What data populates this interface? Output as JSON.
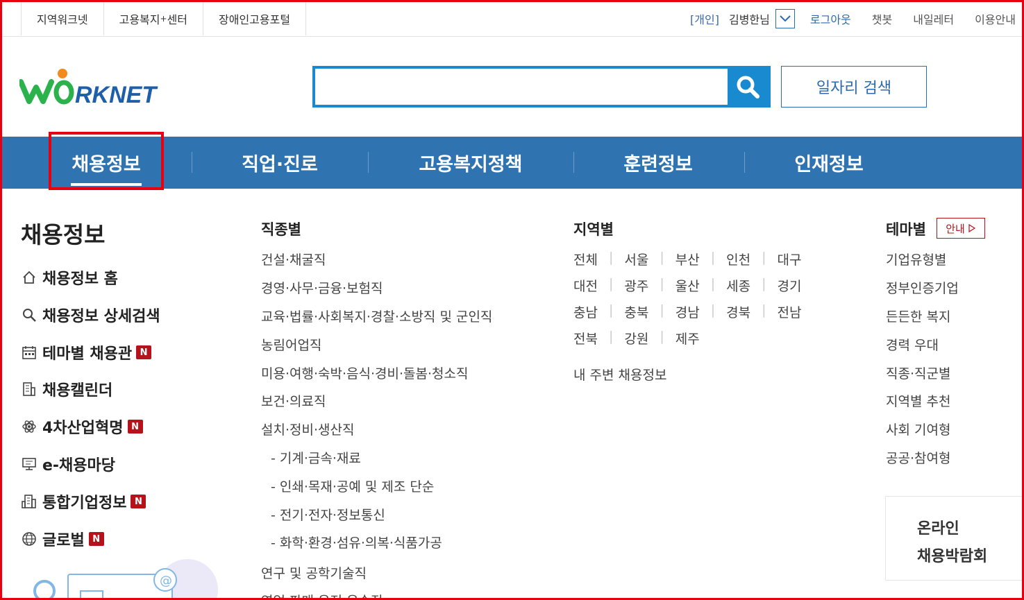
{
  "utility": {
    "left_links": [
      "지역워크넷",
      "고용복지",
      "장애인고용포털"
    ],
    "center_sup": "+",
    "center_suffix": "센터",
    "user_tag": "[개인]",
    "user_name": "김병한님",
    "right_links": [
      "로그아웃",
      "챗봇",
      "내일레터",
      "이용안내"
    ]
  },
  "logo": {
    "text": "WORKNET",
    "colors": {
      "green": "#2bb24c",
      "blue": "#1d5fa8",
      "orange": "#f28a1e"
    }
  },
  "search": {
    "value": "",
    "placeholder": "",
    "job_search_label": "일자리 검색"
  },
  "gnb": {
    "items": [
      "채용정보",
      "직업·진로",
      "고용복지정책",
      "훈련정보",
      "인재정보"
    ],
    "active_index": 0
  },
  "left_panel": {
    "title": "채용정보",
    "items": [
      {
        "label": "채용정보 홈",
        "icon": "home-icon",
        "new": false
      },
      {
        "label": "채용정보 상세검색",
        "icon": "search-icon",
        "new": false
      },
      {
        "label": "테마별 채용관",
        "icon": "calendar-icon",
        "new": true
      },
      {
        "label": "채용캘린더",
        "icon": "building-icon",
        "new": false
      },
      {
        "label": "4차산업혁명",
        "icon": "atom-icon",
        "new": true
      },
      {
        "label": "e-채용마당",
        "icon": "monitor-icon",
        "new": false
      },
      {
        "label": "통합기업정보",
        "icon": "company-icon",
        "new": true
      },
      {
        "label": "글로벌",
        "icon": "globe-icon",
        "new": true
      }
    ],
    "new_badge": "N"
  },
  "job_types": {
    "heading": "직종별",
    "items": [
      "건설·채굴직",
      "경영·사무·금융·보험직",
      "교육·법률·사회복지·경찰·소방직 및 군인직",
      "농림어업직",
      "미용·여행·숙박·음식·경비·돌봄·청소직",
      "보건·의료직",
      "설치·정비·생산직",
      "- 기계·금속·재료",
      "- 인쇄·목재·공예 및 제조 단순",
      "- 전기·전자·정보통신",
      "- 화학·환경·섬유·의복·식품가공",
      "연구 및 공학기술직",
      "영업·판매·운전·운송직"
    ]
  },
  "regions": {
    "heading": "지역별",
    "rows": [
      [
        "전체",
        "서울",
        "부산",
        "인천",
        "대구"
      ],
      [
        "대전",
        "광주",
        "울산",
        "세종",
        "경기"
      ],
      [
        "충남",
        "충북",
        "경남",
        "경북",
        "전남"
      ],
      [
        "전북",
        "강원",
        "제주"
      ]
    ],
    "nearby": "내 주변 채용정보"
  },
  "themes": {
    "heading": "테마별",
    "guide_label": "안내",
    "items": [
      "기업유형별",
      "정부인증기업",
      "든든한 복지",
      "경력 우대",
      "직종·직군별",
      "지역별 추천",
      "사회 기여형",
      "공공·참여형"
    ]
  },
  "fair": {
    "line1": "온라인",
    "line2": "채용박람회"
  },
  "colors": {
    "gnb_bg": "#2f73b0",
    "accent_blue": "#1a8ad0",
    "highlight_red": "#e60012",
    "badge_red": "#b5121b"
  }
}
